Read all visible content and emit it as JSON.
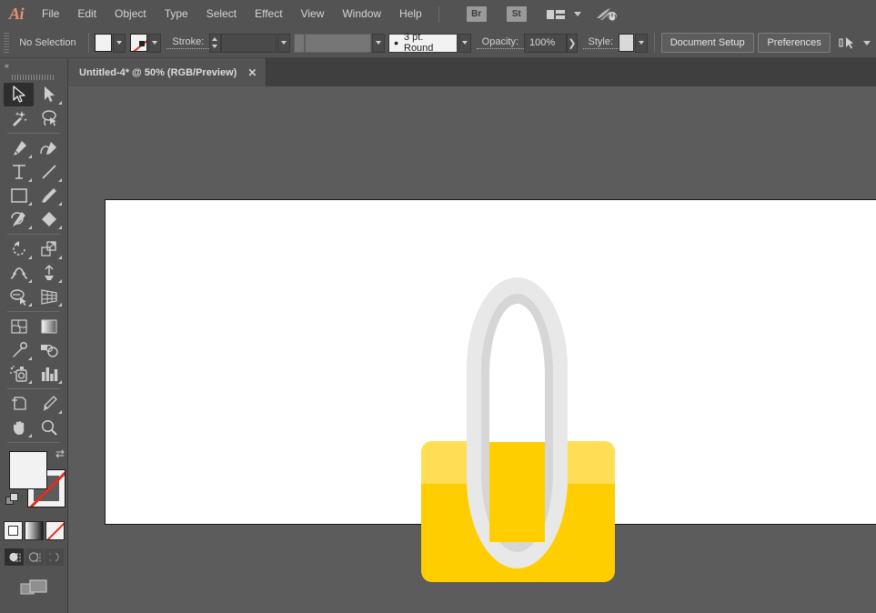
{
  "app": {
    "name": "Adobe Illustrator",
    "logo": "Ai"
  },
  "menubar": {
    "items": [
      {
        "label": "File"
      },
      {
        "label": "Edit"
      },
      {
        "label": "Object"
      },
      {
        "label": "Type"
      },
      {
        "label": "Select"
      },
      {
        "label": "Effect"
      },
      {
        "label": "View"
      },
      {
        "label": "Window"
      },
      {
        "label": "Help"
      }
    ],
    "bridge_label": "Br",
    "stock_label": "St",
    "arrange_icon": "arrange-documents-icon",
    "sync_icon": "cloud-sync-icon"
  },
  "controlbar": {
    "selection_status": "No Selection",
    "fill_swatch": "white",
    "stroke_swatch": "none",
    "stroke_label": "Stroke:",
    "stroke_weight": "",
    "variable_width_profile": "",
    "brush_definition": "3 pt. Round",
    "opacity_label": "Opacity:",
    "opacity_value": "100%",
    "style_label": "Style:",
    "document_setup_label": "Document Setup",
    "preferences_label": "Preferences",
    "align_icon": "align-to-selection-icon"
  },
  "tabbar": {
    "tabs": [
      {
        "title": "Untitled-4* @ 50% (RGB/Preview)",
        "close": "✕",
        "active": true
      }
    ]
  },
  "toolpanel": {
    "collapse_label": "«",
    "groups": [
      {
        "tools": [
          {
            "name": "selection-tool",
            "active": true,
            "flyout": false
          },
          {
            "name": "direct-selection-tool",
            "active": false,
            "flyout": true
          },
          {
            "name": "magic-wand-tool",
            "active": false,
            "flyout": false
          },
          {
            "name": "lasso-tool",
            "active": false,
            "flyout": false
          }
        ]
      },
      {
        "tools": [
          {
            "name": "pen-tool",
            "active": false,
            "flyout": true
          },
          {
            "name": "curvature-tool",
            "active": false,
            "flyout": false
          },
          {
            "name": "type-tool",
            "active": false,
            "flyout": true
          },
          {
            "name": "line-segment-tool",
            "active": false,
            "flyout": true
          },
          {
            "name": "rectangle-tool",
            "active": false,
            "flyout": true
          },
          {
            "name": "paintbrush-tool",
            "active": false,
            "flyout": true
          },
          {
            "name": "shaper-tool",
            "active": false,
            "flyout": true
          },
          {
            "name": "eraser-tool",
            "active": false,
            "flyout": true
          }
        ]
      },
      {
        "tools": [
          {
            "name": "rotate-tool",
            "active": false,
            "flyout": true
          },
          {
            "name": "scale-tool",
            "active": false,
            "flyout": true
          },
          {
            "name": "width-tool",
            "active": false,
            "flyout": true
          },
          {
            "name": "free-transform-tool",
            "active": false,
            "flyout": true
          },
          {
            "name": "shape-builder-tool",
            "active": false,
            "flyout": true
          },
          {
            "name": "perspective-grid-tool",
            "active": false,
            "flyout": true
          }
        ]
      },
      {
        "tools": [
          {
            "name": "mesh-tool",
            "active": false,
            "flyout": false
          },
          {
            "name": "gradient-tool",
            "active": false,
            "flyout": false
          },
          {
            "name": "eyedropper-tool",
            "active": false,
            "flyout": true
          },
          {
            "name": "blend-tool",
            "active": false,
            "flyout": false
          },
          {
            "name": "symbol-sprayer-tool",
            "active": false,
            "flyout": true
          },
          {
            "name": "column-graph-tool",
            "active": false,
            "flyout": true
          }
        ]
      },
      {
        "tools": [
          {
            "name": "artboard-tool",
            "active": false,
            "flyout": false
          },
          {
            "name": "slice-tool",
            "active": false,
            "flyout": true
          },
          {
            "name": "hand-tool",
            "active": false,
            "flyout": true
          },
          {
            "name": "zoom-tool",
            "active": false,
            "flyout": false
          }
        ]
      }
    ],
    "fill_stroke": {
      "fill_color": "#f2f2f2",
      "stroke_color": "none",
      "swap_icon": "swap-fill-stroke-icon",
      "default_icon": "default-fill-stroke-icon"
    },
    "color_modes": [
      {
        "name": "color-mode-button",
        "type": "white",
        "selected": true
      },
      {
        "name": "gradient-mode-button",
        "type": "gradient",
        "selected": false
      },
      {
        "name": "none-mode-button",
        "type": "none",
        "selected": false
      }
    ],
    "draw_modes": [
      {
        "name": "draw-normal-button",
        "selected": true
      },
      {
        "name": "draw-behind-button",
        "selected": false
      },
      {
        "name": "draw-inside-button",
        "selected": false
      }
    ],
    "screen_mode": "change-screen-mode-icon"
  },
  "canvas": {
    "background_color": "#5c5c5c",
    "artboard": {
      "background_color": "#ffffff",
      "border_color": "#1a1a1a"
    },
    "artwork": {
      "name": "padlock-illustration",
      "body_color": "#ffce00",
      "body_highlight_color": "#ffdd55",
      "shackle_outer_color": "#e8e8e8",
      "shackle_inner_color": "#d6d6d6"
    }
  }
}
